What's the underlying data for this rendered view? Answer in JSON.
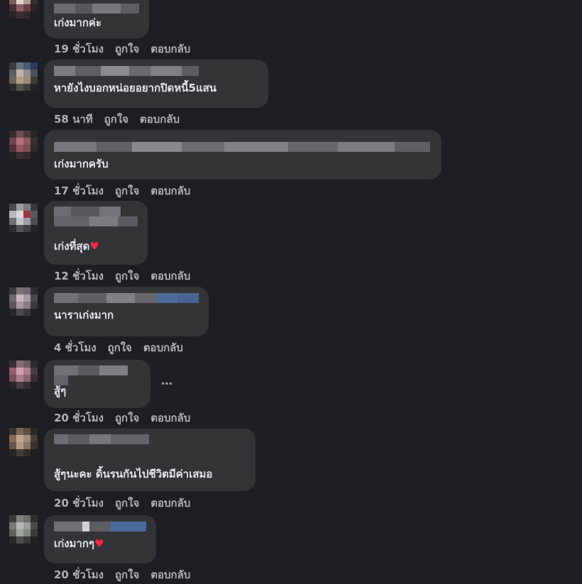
{
  "actions": {
    "like": "ถูกใจ",
    "reply": "ตอบกลับ"
  },
  "more_glyph": "…",
  "heart_glyph": "♥",
  "comments": [
    {
      "text": "เก่งมากค่ะ",
      "time": "19 ชั่วโมง",
      "heart": ""
    },
    {
      "text": "หายังไงบอกหน่อยอยากปิดหนี้5แสน",
      "time": "58 นาที",
      "heart": ""
    },
    {
      "text": "เก่งมากครับ",
      "time": "17 ชั่วโมง",
      "heart": ""
    },
    {
      "text": "เก่งที่สุด",
      "time": "12 ชั่วโมง",
      "heart": "♥"
    },
    {
      "text": "นาราเก่งมาก",
      "time": "4 ชั่วโมง",
      "heart": ""
    },
    {
      "text": "สู้ๆ",
      "time": "20 ชั่วโมง",
      "heart": ""
    },
    {
      "text": "สู้ๆนะคะ ดิ้นรนกันไปชีวิตมีค่าเสมอ",
      "time": "20 ชั่วโมง",
      "heart": ""
    },
    {
      "text": "เก่งมากๆ",
      "time": "20 ชั่วโมง",
      "heart": "♥"
    }
  ],
  "colors": {
    "background": "#1c1e21",
    "bubble": "#333436",
    "meta_text": "#b0b3b8",
    "heart": "#f02849"
  }
}
